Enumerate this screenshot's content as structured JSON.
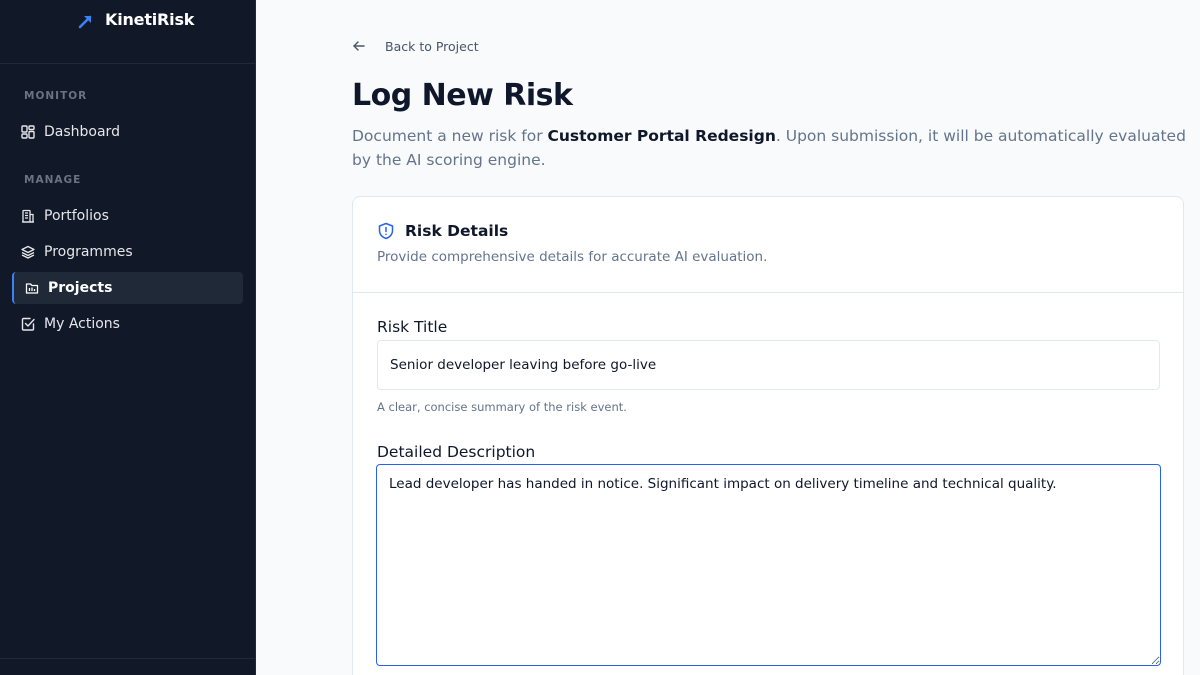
{
  "app": {
    "name": "KinetiRisk",
    "logo_icon": "arrow-up-right-icon",
    "accent": "#3b82f6"
  },
  "sidebar": {
    "sections": [
      {
        "label": "MONITOR"
      },
      {
        "label": "MANAGE"
      }
    ],
    "items": [
      {
        "label": "Dashboard",
        "icon": "grid-icon",
        "active": false
      },
      {
        "label": "Portfolios",
        "icon": "building-icon",
        "active": false
      },
      {
        "label": "Programmes",
        "icon": "layers-icon",
        "active": false
      },
      {
        "label": "Projects",
        "icon": "folder-icon",
        "active": true
      },
      {
        "label": "My Actions",
        "icon": "checkbox-icon",
        "active": false
      }
    ]
  },
  "page": {
    "back_label": "Back to Project",
    "title": "Log New Risk",
    "subtitle_prefix": "Document a new risk for ",
    "project_name": "Customer Portal Redesign",
    "subtitle_suffix": ". Upon submission, it will be automatically evaluated by the AI scoring engine."
  },
  "card": {
    "title": "Risk Details",
    "icon": "shield-alert-icon",
    "description": "Provide comprehensive details for accurate AI evaluation."
  },
  "form": {
    "risk_title_label": "Risk Title",
    "risk_title_value": "Senior developer leaving before go-live",
    "risk_title_hint": "A clear, concise summary of the risk event.",
    "description_label": "Detailed Description",
    "description_value": "Lead developer has handed in notice. Significant impact on delivery timeline and technical quality."
  }
}
